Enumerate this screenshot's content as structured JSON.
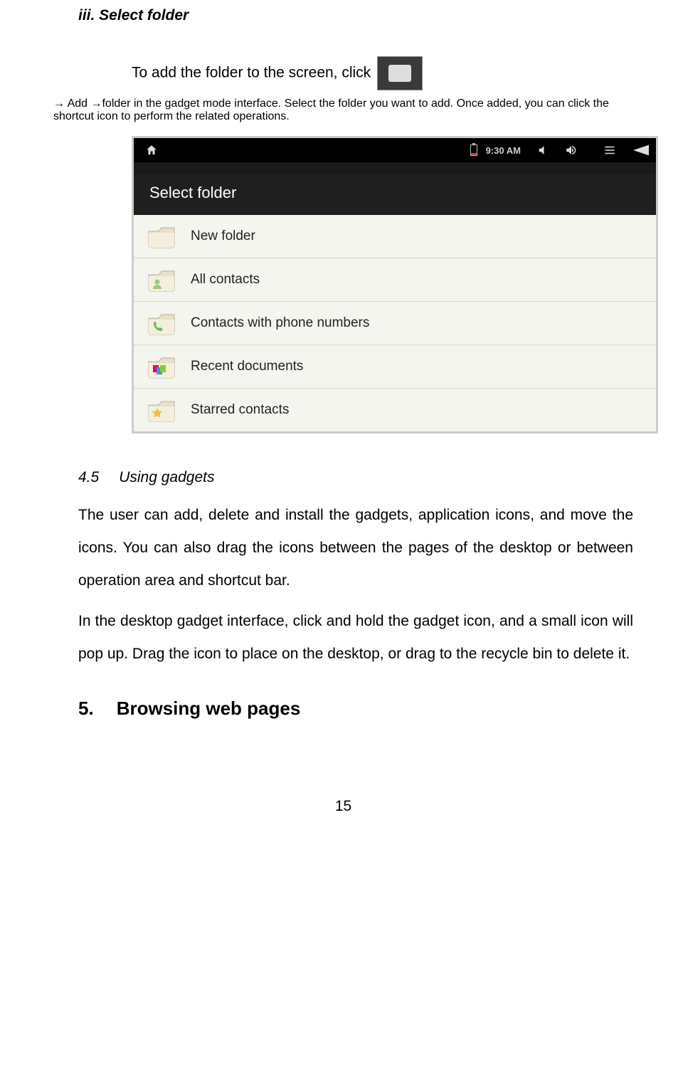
{
  "headings": {
    "iii": "iii. Select folder",
    "h45_num": "4.5",
    "h45_title": "Using gadgets",
    "h5_num": "5.",
    "h5_title": "Browsing web pages"
  },
  "para1_a": "To add the folder to the screen, click ",
  "para1_b": " → Add →folder in the gadget mode interface. Select the folder you want to add. Once added, you can click the shortcut icon to perform the related operations.",
  "para2": "The user can add, delete and install the gadgets, application icons, and move the icons. You can also drag the icons between the pages of the desktop or between operation area and shortcut bar.",
  "para3": "In the desktop gadget interface, click and hold the gadget icon, and a small icon will pop up. Drag the icon to place on the desktop, or drag to the recycle bin to delete it.",
  "screenshot": {
    "statusbar": {
      "time": "9:30 AM"
    },
    "panel_title": "Select folder",
    "items": [
      {
        "label": "New folder",
        "icon": "folder-plain"
      },
      {
        "label": "All contacts",
        "icon": "folder-contact"
      },
      {
        "label": "Contacts with phone numbers",
        "icon": "folder-phone"
      },
      {
        "label": "Recent documents",
        "icon": "folder-docs"
      },
      {
        "label": "Starred contacts",
        "icon": "folder-star"
      }
    ]
  },
  "page_number": "15"
}
